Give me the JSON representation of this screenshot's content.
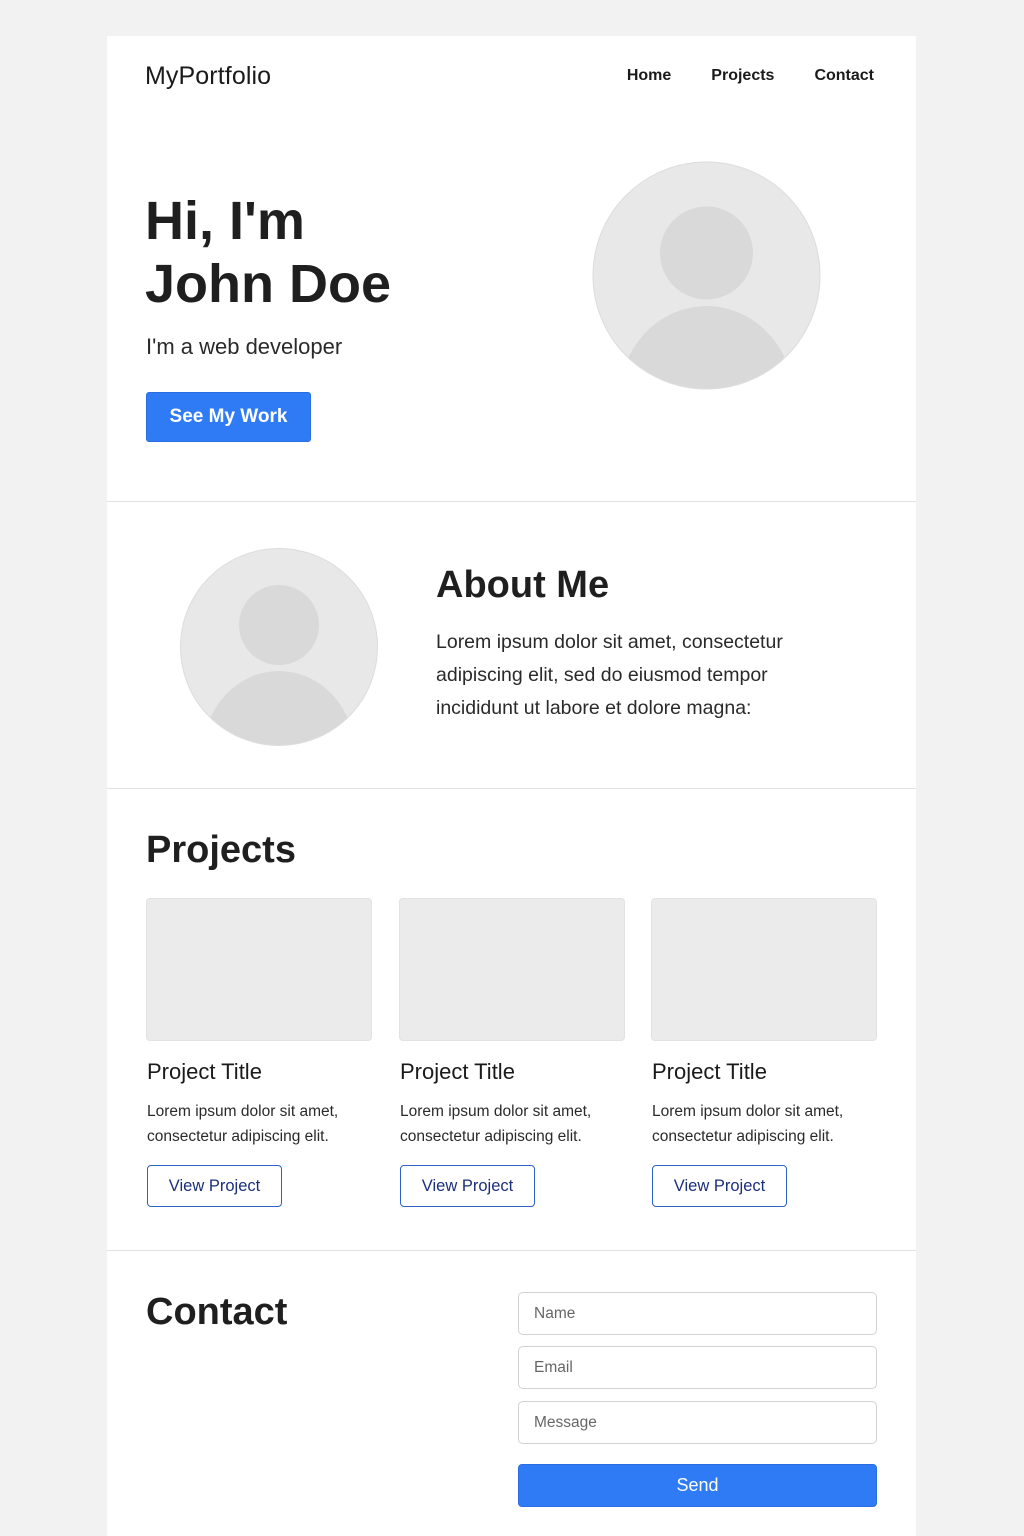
{
  "nav": {
    "brand": "MyPortfolio",
    "links": [
      "Home",
      "Projects",
      "Contact"
    ]
  },
  "hero": {
    "title_line1": "Hi, I'm",
    "title_line2": "John Doe",
    "subtitle": "I'm a web developer",
    "cta_label": "See My Work"
  },
  "about": {
    "title": "About Me",
    "text": "Lorem ipsum dolor sit amet, consectetur adipiscing elit, sed do eiusmod tempor incididunt ut labore et dolore magna:"
  },
  "projects": {
    "title": "Projects",
    "items": [
      {
        "title": "Project Title",
        "description": "Lorem ipsum dolor sit amet, consectetur adipiscing elit.",
        "button_label": "View Project"
      },
      {
        "title": "Project Title",
        "description": "Lorem ipsum dolor sit amet, consectetur adipiscing elit.",
        "button_label": "View Project"
      },
      {
        "title": "Project Title",
        "description": "Lorem ipsum dolor sit amet, consectetur adipiscing elit.",
        "button_label": "View Project"
      }
    ]
  },
  "contact": {
    "title": "Contact",
    "name_placeholder": "Name",
    "email_placeholder": "Email",
    "message_placeholder": "Message",
    "send_label": "Send"
  },
  "icons": {
    "avatar": "user-silhouette-icon"
  },
  "colors": {
    "accent": "#2f7bf5",
    "outline_button_text": "#1b2f7a",
    "outline_button_border": "#2f62c8",
    "placeholder_bg": "#ebebeb",
    "avatar_bg": "#e8e8e8",
    "avatar_figure": "#d9d9d9"
  }
}
